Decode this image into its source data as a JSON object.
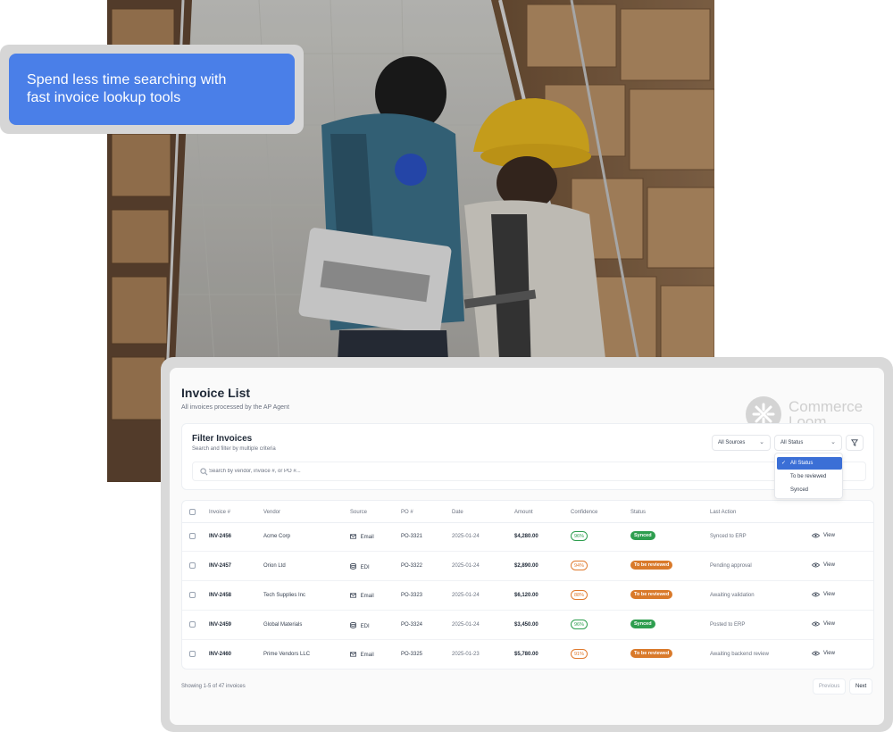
{
  "callout": {
    "text_line1": "Spend less time searching with",
    "text_line2": "fast invoice lookup tools"
  },
  "brand": {
    "name_line1": "Commerce",
    "name_line2": "Loom"
  },
  "page": {
    "title": "Invoice List",
    "subtitle": "All invoices processed by the AP Agent"
  },
  "filters": {
    "title": "Filter Invoices",
    "subtitle": "Search and filter by multiple criteria",
    "source_select": "All Sources",
    "status_select": "All Status",
    "search_placeholder": "Search by vendor, invoice #, or PO #..."
  },
  "status_dropdown": {
    "options": [
      "All Status",
      "To be reviewed",
      "Synced"
    ],
    "selected": "All Status"
  },
  "table": {
    "columns": [
      "Invoice #",
      "Vendor",
      "Source",
      "PO #",
      "Date",
      "Amount",
      "Confidence",
      "Status",
      "Last Action"
    ],
    "rows": [
      {
        "invoice": "INV-2456",
        "vendor": "Acme Corp",
        "source": "Email",
        "source_icon": "mail-icon",
        "po": "PO-3321",
        "date": "2025-01-24",
        "amount": "$4,280.00",
        "confidence": "96%",
        "confidence_color": "#2e9e4f",
        "status": "Synced",
        "status_color": "#2e9e4f",
        "last_action": "Synced to ERP",
        "action": "View"
      },
      {
        "invoice": "INV-2457",
        "vendor": "Orion Ltd",
        "source": "EDI",
        "source_icon": "database-icon",
        "po": "PO-3322",
        "date": "2025-01-24",
        "amount": "$2,890.00",
        "confidence": "94%",
        "confidence_color": "#e07a2e",
        "status": "To be reviewed",
        "status_color": "#d97a2b",
        "last_action": "Pending approval",
        "action": "View"
      },
      {
        "invoice": "INV-2458",
        "vendor": "Tech Supplies Inc",
        "source": "Email",
        "source_icon": "mail-icon",
        "po": "PO-3323",
        "date": "2025-01-24",
        "amount": "$6,120.00",
        "confidence": "88%",
        "confidence_color": "#e07a2e",
        "status": "To be reviewed",
        "status_color": "#d97a2b",
        "last_action": "Awaiting validation",
        "action": "View"
      },
      {
        "invoice": "INV-2459",
        "vendor": "Global Materials",
        "source": "EDI",
        "source_icon": "database-icon",
        "po": "PO-3324",
        "date": "2025-01-24",
        "amount": "$3,450.00",
        "confidence": "96%",
        "confidence_color": "#2e9e4f",
        "status": "Synced",
        "status_color": "#2e9e4f",
        "last_action": "Posted to ERP",
        "action": "View"
      },
      {
        "invoice": "INV-2460",
        "vendor": "Prime Vendors LLC",
        "source": "Email",
        "source_icon": "mail-icon",
        "po": "PO-3325",
        "date": "2025-01-23",
        "amount": "$5,780.00",
        "confidence": "91%",
        "confidence_color": "#e07a2e",
        "status": "To be reviewed",
        "status_color": "#d97a2b",
        "last_action": "Awaiting backend review",
        "action": "View"
      }
    ]
  },
  "footer": {
    "showing": "Showing 1-5 of 47 invoices",
    "previous": "Previous",
    "next": "Next"
  },
  "colors": {
    "accent": "#4a7fe8",
    "selected": "#3b6fd6"
  }
}
